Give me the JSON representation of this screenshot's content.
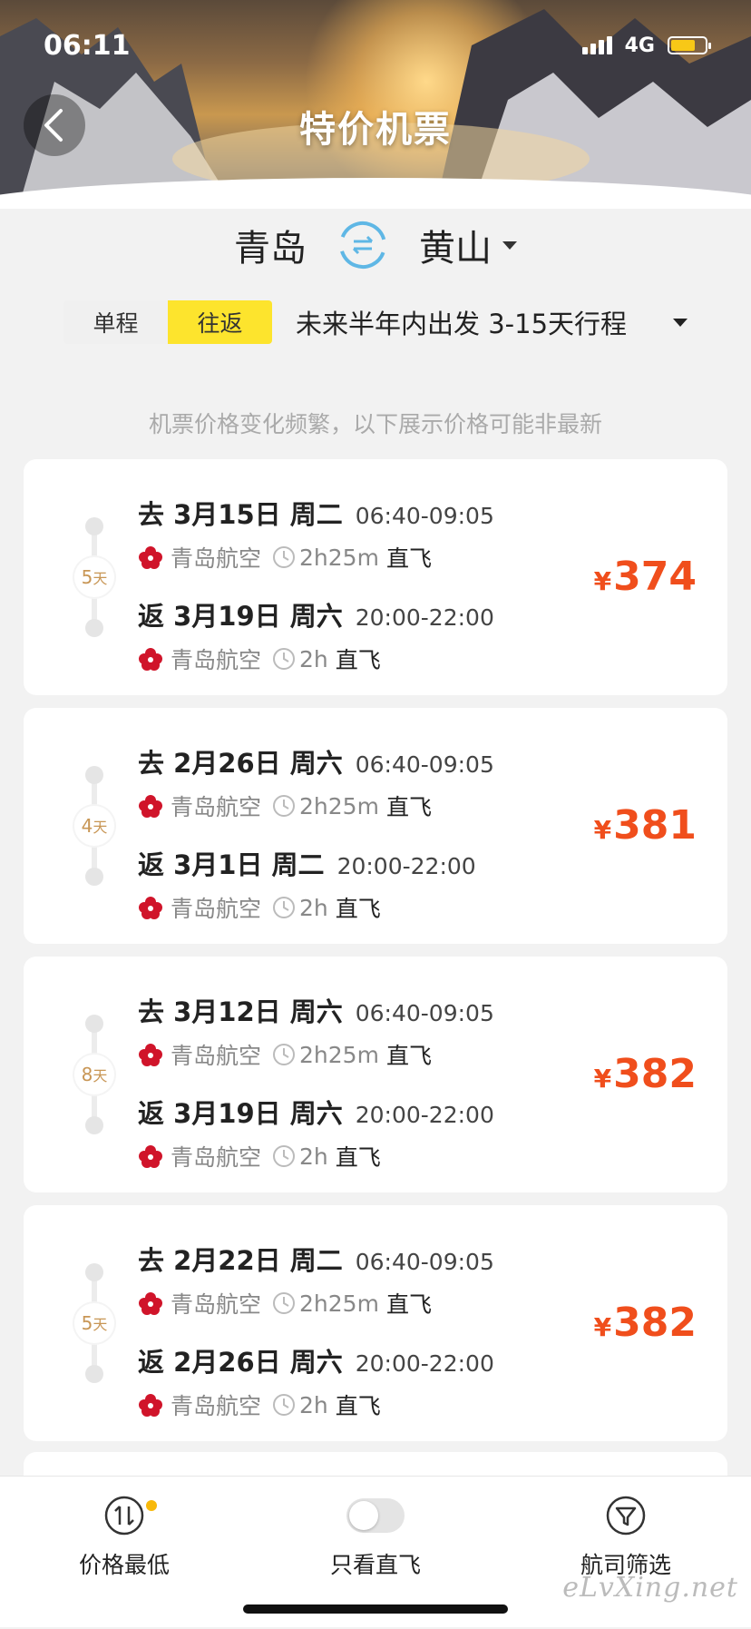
{
  "status_bar": {
    "time": "06:11",
    "network": "4G"
  },
  "header": {
    "title": "特价机票"
  },
  "route": {
    "origin": "青岛",
    "destination": "黄山"
  },
  "trip_type": {
    "one_way": "单程",
    "round_trip": "往返",
    "selected": "往返"
  },
  "date_filter": {
    "label": "未来半年内出发 3-15天行程"
  },
  "notice": "机票价格变化频繁，以下展示价格可能非最新",
  "currency_symbol": "¥",
  "colors": {
    "accent_yellow": "#fde42d",
    "price": "#f04e1c",
    "days": "#c89655"
  },
  "results": [
    {
      "days": "5",
      "days_unit": "天",
      "out": {
        "label": "去 3月15日 周二",
        "time": "06:40-09:05",
        "airline": "青岛航空",
        "duration": "2h25m",
        "type": "直飞"
      },
      "ret": {
        "label": "返 3月19日 周六",
        "time": "20:00-22:00",
        "airline": "青岛航空",
        "duration": "2h",
        "type": "直飞"
      },
      "price": "374"
    },
    {
      "days": "4",
      "days_unit": "天",
      "out": {
        "label": "去 2月26日 周六",
        "time": "06:40-09:05",
        "airline": "青岛航空",
        "duration": "2h25m",
        "type": "直飞"
      },
      "ret": {
        "label": "返 3月1日 周二",
        "time": "20:00-22:00",
        "airline": "青岛航空",
        "duration": "2h",
        "type": "直飞"
      },
      "price": "381"
    },
    {
      "days": "8",
      "days_unit": "天",
      "out": {
        "label": "去 3月12日 周六",
        "time": "06:40-09:05",
        "airline": "青岛航空",
        "duration": "2h25m",
        "type": "直飞"
      },
      "ret": {
        "label": "返 3月19日 周六",
        "time": "20:00-22:00",
        "airline": "青岛航空",
        "duration": "2h",
        "type": "直飞"
      },
      "price": "382"
    },
    {
      "days": "5",
      "days_unit": "天",
      "out": {
        "label": "去 2月22日 周二",
        "time": "06:40-09:05",
        "airline": "青岛航空",
        "duration": "2h25m",
        "type": "直飞"
      },
      "ret": {
        "label": "返 2月26日 周六",
        "time": "20:00-22:00",
        "airline": "青岛航空",
        "duration": "2h",
        "type": "直飞"
      },
      "price": "382"
    }
  ],
  "tabbar": {
    "sort_price": "价格最低",
    "direct_only": "只看直飞",
    "direct_only_on": false,
    "airline_filter": "航司筛选"
  },
  "watermark": "eLvXing.net"
}
